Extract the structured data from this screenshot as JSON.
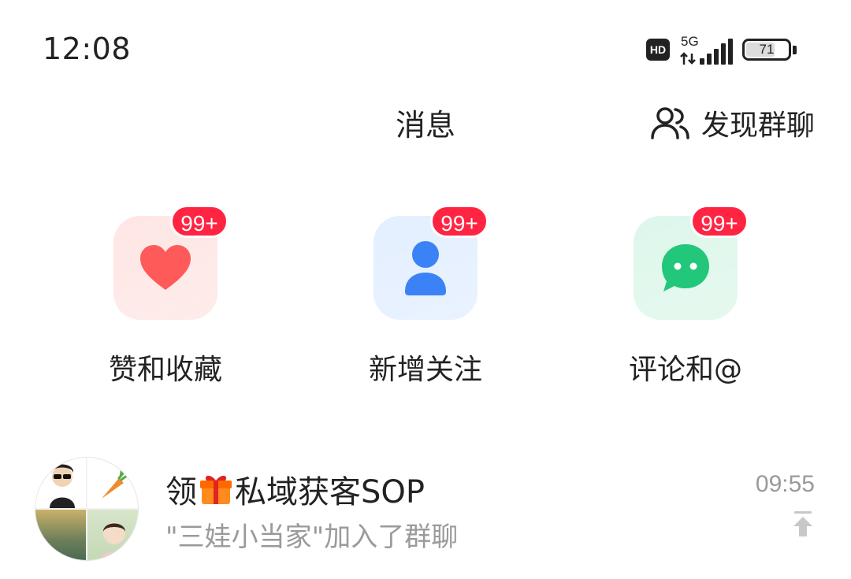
{
  "status_bar": {
    "time": "12:08",
    "hd_label": "HD",
    "network": "5G",
    "battery_level": 71,
    "battery_text": "71"
  },
  "header": {
    "title": "消息",
    "discover_label": "发现群聊",
    "discover_icon": "group-users-icon"
  },
  "quick_actions": [
    {
      "label": "赞和收藏",
      "badge": "99+",
      "icon": "heart-icon",
      "color": "#ff5a5a"
    },
    {
      "label": "新增关注",
      "badge": "99+",
      "icon": "person-icon",
      "color": "#3b82f6"
    },
    {
      "label": "评论和@",
      "badge": "99+",
      "icon": "chat-bubble-icon",
      "color": "#22c77a"
    }
  ],
  "badge_color": "#ff2442",
  "conversations": [
    {
      "title_prefix": "领",
      "title_emoji": "gift-icon",
      "title_suffix": "私域获客SOP",
      "preview": "\"三娃小当家\"加入了群聊",
      "time": "09:55",
      "pinned_icon": "pin-to-top-icon"
    }
  ]
}
